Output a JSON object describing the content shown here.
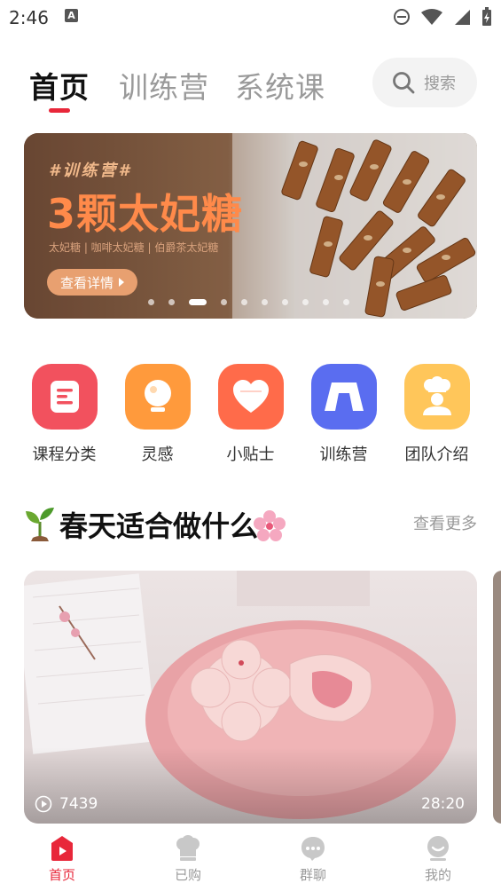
{
  "status": {
    "time": "2:46"
  },
  "tabs": {
    "home": "首页",
    "camp": "训练营",
    "course": "系统课"
  },
  "search": {
    "label": "搜索"
  },
  "banner": {
    "tag": "#训练营#",
    "title": "3颗太妃糖",
    "subtitle": "太妃糖 | 咖啡太妃糖 | 伯爵茶太妃糖",
    "button": "查看详情",
    "dot_count": 10,
    "active_dot": 2
  },
  "quick_links": [
    {
      "label": "课程分类",
      "icon": "document-icon",
      "color": "#f2515e"
    },
    {
      "label": "灵感",
      "icon": "lightbulb-icon",
      "color": "#ff9a3c"
    },
    {
      "label": "小贴士",
      "icon": "heart-icon",
      "color": "#ff6b4a"
    },
    {
      "label": "训练营",
      "icon": "camp-icon",
      "color": "#5a6df0"
    },
    {
      "label": "团队介绍",
      "icon": "chef-icon",
      "color": "#ffc65a"
    }
  ],
  "section": {
    "title": "春天适合做什么",
    "more": "查看更多"
  },
  "video": {
    "views": "7439",
    "duration": "28:20"
  },
  "nav": {
    "home": "首页",
    "bought": "已购",
    "group": "群聊",
    "mine": "我的"
  },
  "colors": {
    "accent": "#e8273a"
  }
}
